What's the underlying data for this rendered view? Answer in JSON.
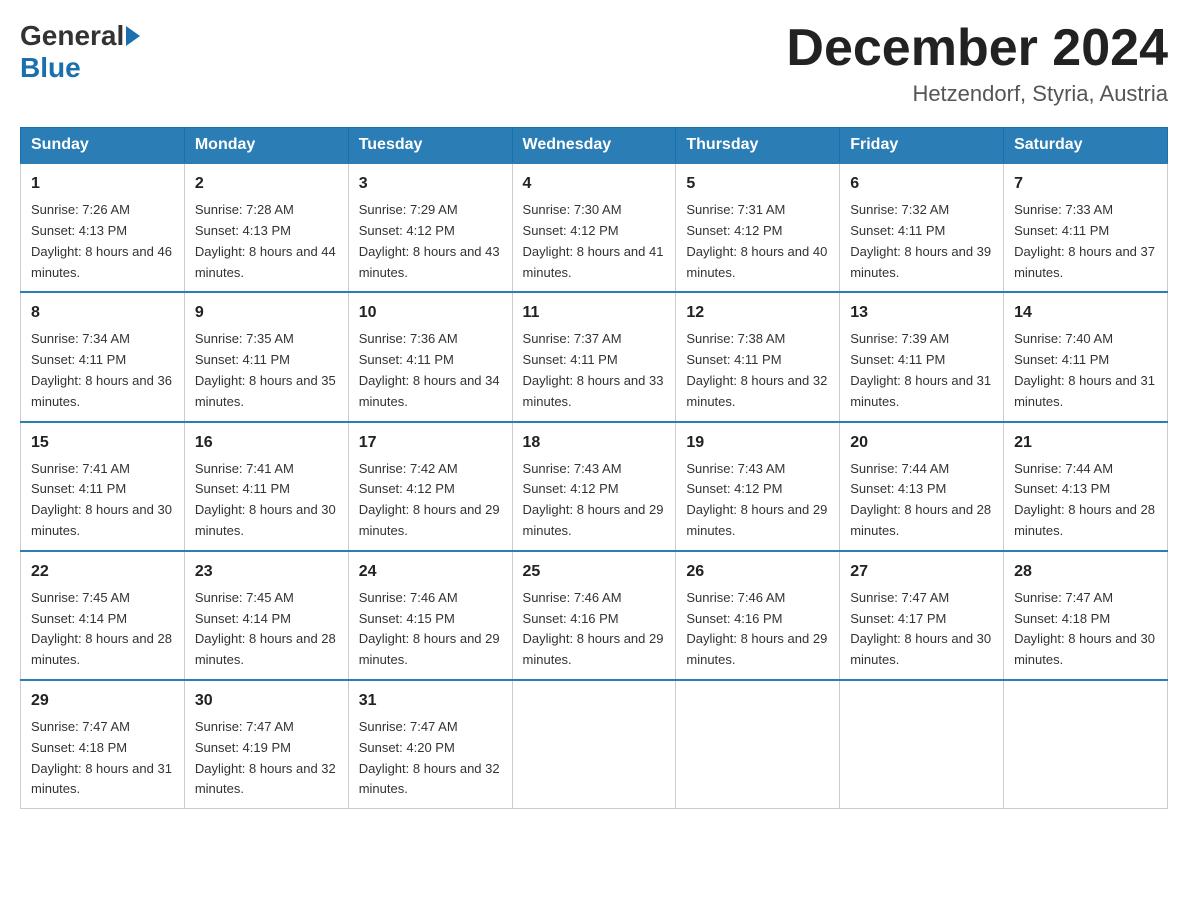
{
  "header": {
    "logo_general": "General",
    "logo_blue": "Blue",
    "month_title": "December 2024",
    "location": "Hetzendorf, Styria, Austria"
  },
  "days_of_week": [
    "Sunday",
    "Monday",
    "Tuesday",
    "Wednesday",
    "Thursday",
    "Friday",
    "Saturday"
  ],
  "weeks": [
    [
      {
        "day": "1",
        "sunrise": "7:26 AM",
        "sunset": "4:13 PM",
        "daylight": "8 hours and 46 minutes."
      },
      {
        "day": "2",
        "sunrise": "7:28 AM",
        "sunset": "4:13 PM",
        "daylight": "8 hours and 44 minutes."
      },
      {
        "day": "3",
        "sunrise": "7:29 AM",
        "sunset": "4:12 PM",
        "daylight": "8 hours and 43 minutes."
      },
      {
        "day": "4",
        "sunrise": "7:30 AM",
        "sunset": "4:12 PM",
        "daylight": "8 hours and 41 minutes."
      },
      {
        "day": "5",
        "sunrise": "7:31 AM",
        "sunset": "4:12 PM",
        "daylight": "8 hours and 40 minutes."
      },
      {
        "day": "6",
        "sunrise": "7:32 AM",
        "sunset": "4:11 PM",
        "daylight": "8 hours and 39 minutes."
      },
      {
        "day": "7",
        "sunrise": "7:33 AM",
        "sunset": "4:11 PM",
        "daylight": "8 hours and 37 minutes."
      }
    ],
    [
      {
        "day": "8",
        "sunrise": "7:34 AM",
        "sunset": "4:11 PM",
        "daylight": "8 hours and 36 minutes."
      },
      {
        "day": "9",
        "sunrise": "7:35 AM",
        "sunset": "4:11 PM",
        "daylight": "8 hours and 35 minutes."
      },
      {
        "day": "10",
        "sunrise": "7:36 AM",
        "sunset": "4:11 PM",
        "daylight": "8 hours and 34 minutes."
      },
      {
        "day": "11",
        "sunrise": "7:37 AM",
        "sunset": "4:11 PM",
        "daylight": "8 hours and 33 minutes."
      },
      {
        "day": "12",
        "sunrise": "7:38 AM",
        "sunset": "4:11 PM",
        "daylight": "8 hours and 32 minutes."
      },
      {
        "day": "13",
        "sunrise": "7:39 AM",
        "sunset": "4:11 PM",
        "daylight": "8 hours and 31 minutes."
      },
      {
        "day": "14",
        "sunrise": "7:40 AM",
        "sunset": "4:11 PM",
        "daylight": "8 hours and 31 minutes."
      }
    ],
    [
      {
        "day": "15",
        "sunrise": "7:41 AM",
        "sunset": "4:11 PM",
        "daylight": "8 hours and 30 minutes."
      },
      {
        "day": "16",
        "sunrise": "7:41 AM",
        "sunset": "4:11 PM",
        "daylight": "8 hours and 30 minutes."
      },
      {
        "day": "17",
        "sunrise": "7:42 AM",
        "sunset": "4:12 PM",
        "daylight": "8 hours and 29 minutes."
      },
      {
        "day": "18",
        "sunrise": "7:43 AM",
        "sunset": "4:12 PM",
        "daylight": "8 hours and 29 minutes."
      },
      {
        "day": "19",
        "sunrise": "7:43 AM",
        "sunset": "4:12 PM",
        "daylight": "8 hours and 29 minutes."
      },
      {
        "day": "20",
        "sunrise": "7:44 AM",
        "sunset": "4:13 PM",
        "daylight": "8 hours and 28 minutes."
      },
      {
        "day": "21",
        "sunrise": "7:44 AM",
        "sunset": "4:13 PM",
        "daylight": "8 hours and 28 minutes."
      }
    ],
    [
      {
        "day": "22",
        "sunrise": "7:45 AM",
        "sunset": "4:14 PM",
        "daylight": "8 hours and 28 minutes."
      },
      {
        "day": "23",
        "sunrise": "7:45 AM",
        "sunset": "4:14 PM",
        "daylight": "8 hours and 28 minutes."
      },
      {
        "day": "24",
        "sunrise": "7:46 AM",
        "sunset": "4:15 PM",
        "daylight": "8 hours and 29 minutes."
      },
      {
        "day": "25",
        "sunrise": "7:46 AM",
        "sunset": "4:16 PM",
        "daylight": "8 hours and 29 minutes."
      },
      {
        "day": "26",
        "sunrise": "7:46 AM",
        "sunset": "4:16 PM",
        "daylight": "8 hours and 29 minutes."
      },
      {
        "day": "27",
        "sunrise": "7:47 AM",
        "sunset": "4:17 PM",
        "daylight": "8 hours and 30 minutes."
      },
      {
        "day": "28",
        "sunrise": "7:47 AM",
        "sunset": "4:18 PM",
        "daylight": "8 hours and 30 minutes."
      }
    ],
    [
      {
        "day": "29",
        "sunrise": "7:47 AM",
        "sunset": "4:18 PM",
        "daylight": "8 hours and 31 minutes."
      },
      {
        "day": "30",
        "sunrise": "7:47 AM",
        "sunset": "4:19 PM",
        "daylight": "8 hours and 32 minutes."
      },
      {
        "day": "31",
        "sunrise": "7:47 AM",
        "sunset": "4:20 PM",
        "daylight": "8 hours and 32 minutes."
      },
      null,
      null,
      null,
      null
    ]
  ]
}
